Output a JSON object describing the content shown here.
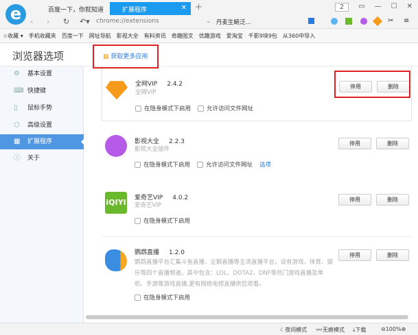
{
  "tabs": [
    {
      "label": "百度一下，你就知道"
    },
    {
      "label": "扩展程序"
    }
  ],
  "tab_count": "2",
  "address": "chrome://extensions",
  "search_suggestion": "丹麦生鲢泛...",
  "bookmarks": [
    "收藏",
    "手机收藏夹",
    "百度一下",
    "网址导航",
    "影视大全",
    "有料资讯",
    "奇趣图文",
    "优趣游戏",
    "爱淘宝",
    "千影9块9包",
    "从360中导入"
  ],
  "page_title": "浏览器选项",
  "get_more": "获取更多应用",
  "sidebar": [
    {
      "label": "基本设置",
      "icon": "gear-icon"
    },
    {
      "label": "快捷键",
      "icon": "keyboard-icon"
    },
    {
      "label": "鼠标手势",
      "icon": "mouse-icon"
    },
    {
      "label": "高级设置",
      "icon": "advanced-icon"
    },
    {
      "label": "扩展程序",
      "icon": "extensions-icon"
    },
    {
      "label": "关于",
      "icon": "info-icon"
    }
  ],
  "labels": {
    "disable": "停用",
    "delete": "删除",
    "incognito": "在隐身模式下启用",
    "file_access": "允许访问文件网址",
    "options": "选项"
  },
  "extensions": [
    {
      "name": "全网VIP",
      "version": "2.4.2",
      "desc": "全网VIP",
      "color": "#f59a1b"
    },
    {
      "name": "影视大全",
      "version": "2.2.3",
      "desc": "影视大全插件",
      "color": "#b65be8"
    },
    {
      "name": "爱奇艺VIP",
      "version": "4.0.2",
      "desc": "爱奇艺VIP",
      "color": "#6ab82b"
    },
    {
      "name": "鹦鹉直播",
      "version": "1.2.0",
      "desc": "鹦鹉直播平台汇集斗鱼直播、企鹅直播等主流直播平台，设有游戏、体育、娱乐等四个直播频道，其中包含：LOL、DOTA2、DNF等热门游戏直播及单机、手游等游戏直播,更有网络电视直播供您观看。",
      "color": "#3a8de0"
    }
  ],
  "status": {
    "night": "夜间模式",
    "incognito": "无痕模式",
    "download": "下载",
    "zoom": "100%"
  }
}
